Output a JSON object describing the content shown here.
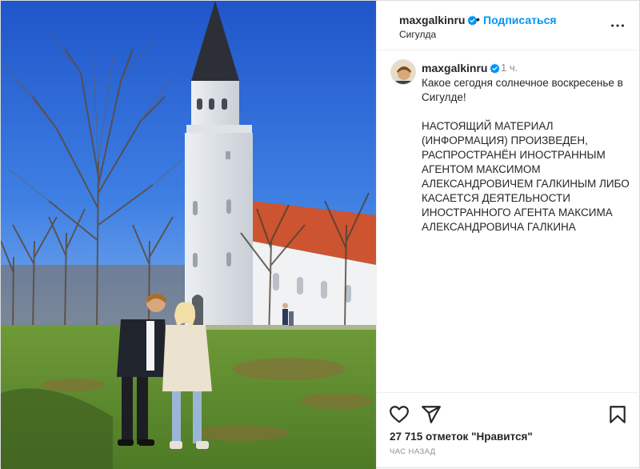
{
  "post": {
    "header": {
      "username": "maxgalkinru",
      "separator": "•",
      "follow_label": "Подписаться",
      "location": "Сигулда",
      "more_icon": "more-horizontal-icon",
      "verified_icon": "verified-badge-icon",
      "verified_color": "#0095f6"
    },
    "caption": {
      "username": "maxgalkinru",
      "time": "1 ч.",
      "line1": "Какое сегодня солнечное воскресенье в Сигулде!",
      "line2": "НАСТОЯЩИЙ МАТЕРИАЛ (ИНФОРМАЦИЯ) ПРОИЗВЕДЕН, РАСПРОСТРАНЁН ИНОСТРАННЫМ АГЕНТОМ МАКСИМОМ АЛЕКСАНДРОВИЧЕМ ГАЛКИНЫМ ЛИБО КАСАЕТСЯ ДЕЯТЕЛЬНОСТИ ИНОСТРАННОГО АГЕНТА МАКСИМА АЛЕКСАНДРОВИЧА ГАЛКИНА"
    },
    "actions": {
      "like_icon": "heart-icon",
      "share_icon": "paper-plane-icon",
      "save_icon": "bookmark-icon"
    },
    "likes_text": "27 715 отметок \"Нравится\"",
    "time_ago": "ЧАС НАЗАД"
  },
  "colors": {
    "link_blue": "#0095f6",
    "sky": "#2f6bd8",
    "grass": "#5d8a2e",
    "roof": "#c8502c"
  }
}
